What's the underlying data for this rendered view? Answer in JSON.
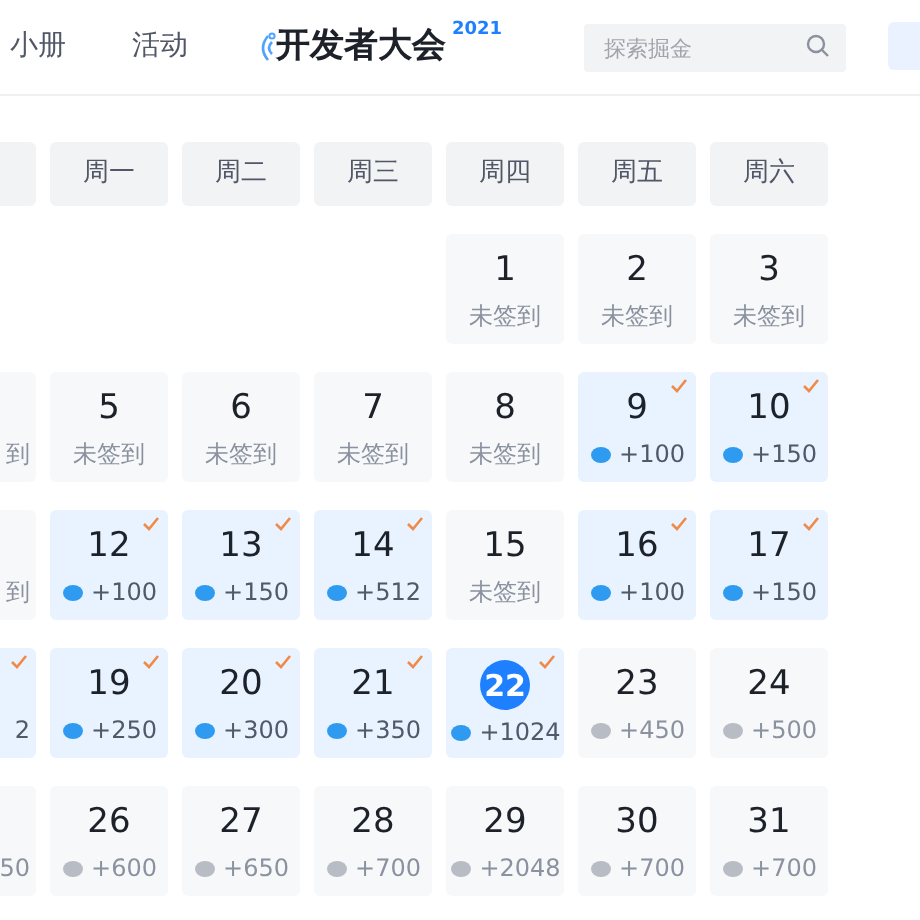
{
  "nav": {
    "links": [
      {
        "label": "小册"
      },
      {
        "label": "活动"
      }
    ],
    "logo": {
      "text": "开发者大会",
      "year": "2021"
    },
    "search": {
      "placeholder": "探索掘金"
    }
  },
  "weekdays": [
    "周一",
    "周二",
    "周三",
    "周四",
    "周五",
    "周六"
  ],
  "weeks": [
    [
      {
        "kind": "blank"
      },
      {
        "kind": "blank"
      },
      {
        "kind": "blank"
      },
      {
        "kind": "blank"
      },
      {
        "day": "1",
        "kind": "missed",
        "note": "未签到"
      },
      {
        "day": "2",
        "kind": "missed",
        "note": "未签到"
      },
      {
        "day": "3",
        "kind": "missed",
        "note": "未签到"
      }
    ],
    [
      {
        "kind": "missed",
        "note": "到"
      },
      {
        "day": "5",
        "kind": "missed",
        "note": "未签到"
      },
      {
        "day": "6",
        "kind": "missed",
        "note": "未签到"
      },
      {
        "day": "7",
        "kind": "missed",
        "note": "未签到"
      },
      {
        "day": "8",
        "kind": "missed",
        "note": "未签到"
      },
      {
        "day": "9",
        "kind": "signed",
        "note": "+100"
      },
      {
        "day": "10",
        "kind": "signed",
        "note": "+150"
      }
    ],
    [
      {
        "kind": "missed",
        "note": "到"
      },
      {
        "day": "12",
        "kind": "signed",
        "note": "+100"
      },
      {
        "day": "13",
        "kind": "signed",
        "note": "+150"
      },
      {
        "day": "14",
        "kind": "signed",
        "note": "+512"
      },
      {
        "day": "15",
        "kind": "missed",
        "note": "未签到"
      },
      {
        "day": "16",
        "kind": "signed",
        "note": "+100"
      },
      {
        "day": "17",
        "kind": "signed",
        "note": "+150"
      }
    ],
    [
      {
        "kind": "signed",
        "note": "2"
      },
      {
        "day": "19",
        "kind": "signed",
        "note": "+250"
      },
      {
        "day": "20",
        "kind": "signed",
        "note": "+300"
      },
      {
        "day": "21",
        "kind": "signed",
        "note": "+350"
      },
      {
        "day": "22",
        "kind": "signed",
        "today": true,
        "note": "+1024"
      },
      {
        "day": "23",
        "kind": "upcoming",
        "note": "+450"
      },
      {
        "day": "24",
        "kind": "upcoming",
        "note": "+500"
      }
    ],
    [
      {
        "kind": "upcoming",
        "note": "50"
      },
      {
        "day": "26",
        "kind": "upcoming",
        "note": "+600"
      },
      {
        "day": "27",
        "kind": "upcoming",
        "note": "+650"
      },
      {
        "day": "28",
        "kind": "upcoming",
        "note": "+700"
      },
      {
        "day": "29",
        "kind": "upcoming",
        "note": "+2048"
      },
      {
        "day": "30",
        "kind": "upcoming",
        "note": "+700"
      },
      {
        "day": "31",
        "kind": "upcoming",
        "note": "+700"
      }
    ]
  ]
}
